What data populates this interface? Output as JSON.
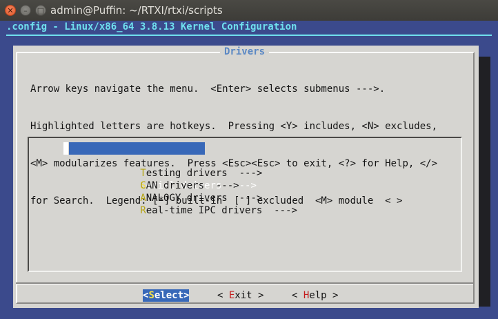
{
  "window": {
    "title": "admin@Puffin: ~/RTXI/rtxi/scripts",
    "close_glyph": "✕",
    "minimize_glyph": "–",
    "maximize_glyph": "□"
  },
  "terminal": {
    "header": ".config - Linux/x86_64 3.8.13 Kernel Configuration"
  },
  "dialog": {
    "title": "Drivers",
    "help_lines": [
      "Arrow keys navigate the menu.  <Enter> selects submenus --->.",
      "Highlighted letters are hotkeys.  Pressing <Y> includes, <N> excludes,",
      "<M> modularizes features.  Press <Esc><Esc> to exit, <?> for Help, </>",
      "for Search.  Legend: [*] built-in  [ ] excluded  <M> module  < >"
    ],
    "menu_items": [
      {
        "hotkey": "S",
        "rest": "erial drivers  --->",
        "selected": true
      },
      {
        "hotkey": "T",
        "rest": "esting drivers  --->",
        "selected": false
      },
      {
        "hotkey": "C",
        "rest": "AN drivers  --->",
        "selected": false
      },
      {
        "hotkey": "A",
        "rest": "NALOGY drivers  --->",
        "selected": false
      },
      {
        "hotkey": "R",
        "rest": "eal-time IPC drivers  --->",
        "selected": false
      }
    ],
    "buttons": {
      "select": {
        "open": "<",
        "hotkey": "S",
        "rest": "elect",
        "close": ">"
      },
      "exit": {
        "open": "< ",
        "hotkey": "E",
        "rest": "xit",
        "close": " >"
      },
      "help": {
        "open": "< ",
        "hotkey": "H",
        "rest": "elp",
        "close": " >"
      }
    }
  },
  "colors": {
    "terminal_bg": "#3b4a8c",
    "header_fg": "#6fe0ee",
    "dialog_bg": "#d6d5d1",
    "dialog_title_fg": "#5b88c4",
    "selection_bg": "#3868b8",
    "hotkey_fg": "#b5a412",
    "button_hotkey_fg": "#c41a1a"
  }
}
